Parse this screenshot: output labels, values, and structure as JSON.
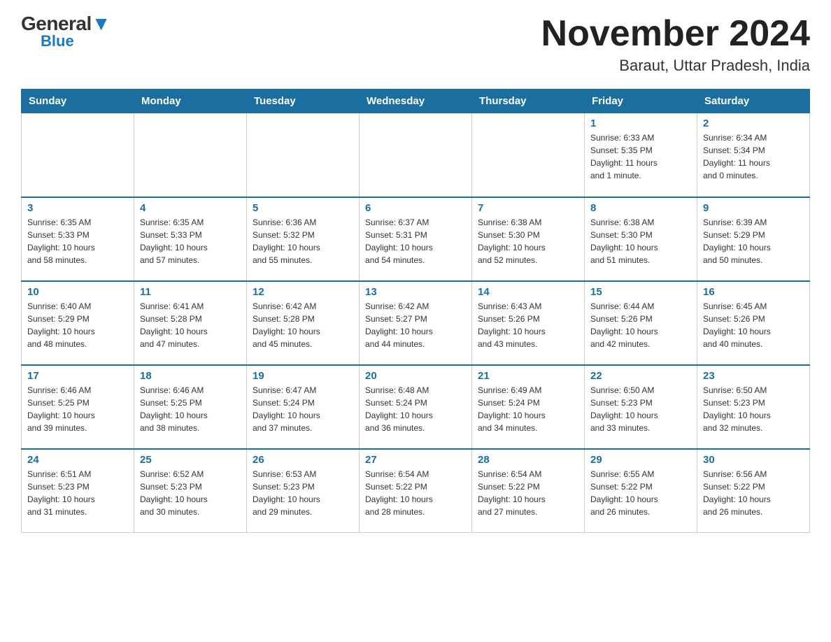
{
  "logo": {
    "general": "General",
    "triangle": "",
    "blue": "Blue"
  },
  "title": "November 2024",
  "subtitle": "Baraut, Uttar Pradesh, India",
  "weekdays": [
    "Sunday",
    "Monday",
    "Tuesday",
    "Wednesday",
    "Thursday",
    "Friday",
    "Saturday"
  ],
  "weeks": [
    [
      {
        "day": "",
        "info": ""
      },
      {
        "day": "",
        "info": ""
      },
      {
        "day": "",
        "info": ""
      },
      {
        "day": "",
        "info": ""
      },
      {
        "day": "",
        "info": ""
      },
      {
        "day": "1",
        "info": "Sunrise: 6:33 AM\nSunset: 5:35 PM\nDaylight: 11 hours\nand 1 minute."
      },
      {
        "day": "2",
        "info": "Sunrise: 6:34 AM\nSunset: 5:34 PM\nDaylight: 11 hours\nand 0 minutes."
      }
    ],
    [
      {
        "day": "3",
        "info": "Sunrise: 6:35 AM\nSunset: 5:33 PM\nDaylight: 10 hours\nand 58 minutes."
      },
      {
        "day": "4",
        "info": "Sunrise: 6:35 AM\nSunset: 5:33 PM\nDaylight: 10 hours\nand 57 minutes."
      },
      {
        "day": "5",
        "info": "Sunrise: 6:36 AM\nSunset: 5:32 PM\nDaylight: 10 hours\nand 55 minutes."
      },
      {
        "day": "6",
        "info": "Sunrise: 6:37 AM\nSunset: 5:31 PM\nDaylight: 10 hours\nand 54 minutes."
      },
      {
        "day": "7",
        "info": "Sunrise: 6:38 AM\nSunset: 5:30 PM\nDaylight: 10 hours\nand 52 minutes."
      },
      {
        "day": "8",
        "info": "Sunrise: 6:38 AM\nSunset: 5:30 PM\nDaylight: 10 hours\nand 51 minutes."
      },
      {
        "day": "9",
        "info": "Sunrise: 6:39 AM\nSunset: 5:29 PM\nDaylight: 10 hours\nand 50 minutes."
      }
    ],
    [
      {
        "day": "10",
        "info": "Sunrise: 6:40 AM\nSunset: 5:29 PM\nDaylight: 10 hours\nand 48 minutes."
      },
      {
        "day": "11",
        "info": "Sunrise: 6:41 AM\nSunset: 5:28 PM\nDaylight: 10 hours\nand 47 minutes."
      },
      {
        "day": "12",
        "info": "Sunrise: 6:42 AM\nSunset: 5:28 PM\nDaylight: 10 hours\nand 45 minutes."
      },
      {
        "day": "13",
        "info": "Sunrise: 6:42 AM\nSunset: 5:27 PM\nDaylight: 10 hours\nand 44 minutes."
      },
      {
        "day": "14",
        "info": "Sunrise: 6:43 AM\nSunset: 5:26 PM\nDaylight: 10 hours\nand 43 minutes."
      },
      {
        "day": "15",
        "info": "Sunrise: 6:44 AM\nSunset: 5:26 PM\nDaylight: 10 hours\nand 42 minutes."
      },
      {
        "day": "16",
        "info": "Sunrise: 6:45 AM\nSunset: 5:26 PM\nDaylight: 10 hours\nand 40 minutes."
      }
    ],
    [
      {
        "day": "17",
        "info": "Sunrise: 6:46 AM\nSunset: 5:25 PM\nDaylight: 10 hours\nand 39 minutes."
      },
      {
        "day": "18",
        "info": "Sunrise: 6:46 AM\nSunset: 5:25 PM\nDaylight: 10 hours\nand 38 minutes."
      },
      {
        "day": "19",
        "info": "Sunrise: 6:47 AM\nSunset: 5:24 PM\nDaylight: 10 hours\nand 37 minutes."
      },
      {
        "day": "20",
        "info": "Sunrise: 6:48 AM\nSunset: 5:24 PM\nDaylight: 10 hours\nand 36 minutes."
      },
      {
        "day": "21",
        "info": "Sunrise: 6:49 AM\nSunset: 5:24 PM\nDaylight: 10 hours\nand 34 minutes."
      },
      {
        "day": "22",
        "info": "Sunrise: 6:50 AM\nSunset: 5:23 PM\nDaylight: 10 hours\nand 33 minutes."
      },
      {
        "day": "23",
        "info": "Sunrise: 6:50 AM\nSunset: 5:23 PM\nDaylight: 10 hours\nand 32 minutes."
      }
    ],
    [
      {
        "day": "24",
        "info": "Sunrise: 6:51 AM\nSunset: 5:23 PM\nDaylight: 10 hours\nand 31 minutes."
      },
      {
        "day": "25",
        "info": "Sunrise: 6:52 AM\nSunset: 5:23 PM\nDaylight: 10 hours\nand 30 minutes."
      },
      {
        "day": "26",
        "info": "Sunrise: 6:53 AM\nSunset: 5:23 PM\nDaylight: 10 hours\nand 29 minutes."
      },
      {
        "day": "27",
        "info": "Sunrise: 6:54 AM\nSunset: 5:22 PM\nDaylight: 10 hours\nand 28 minutes."
      },
      {
        "day": "28",
        "info": "Sunrise: 6:54 AM\nSunset: 5:22 PM\nDaylight: 10 hours\nand 27 minutes."
      },
      {
        "day": "29",
        "info": "Sunrise: 6:55 AM\nSunset: 5:22 PM\nDaylight: 10 hours\nand 26 minutes."
      },
      {
        "day": "30",
        "info": "Sunrise: 6:56 AM\nSunset: 5:22 PM\nDaylight: 10 hours\nand 26 minutes."
      }
    ]
  ]
}
